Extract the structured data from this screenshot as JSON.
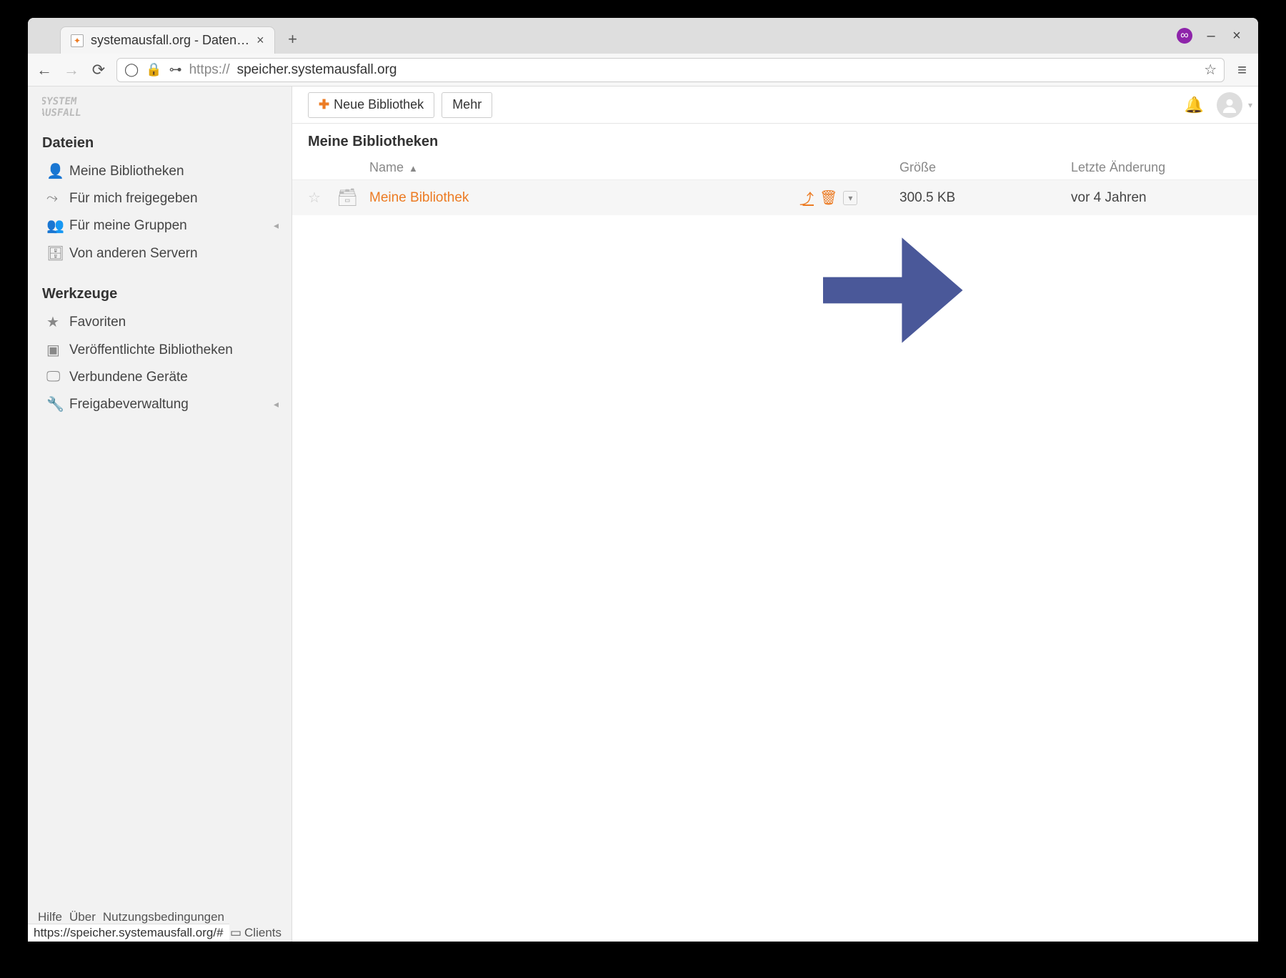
{
  "browser": {
    "tab_title": "systemausfall.org - Daten…",
    "url_proto": "https://",
    "url_host": "speicher.systemausfall.org",
    "status_url": "https://speicher.systemausfall.org/#"
  },
  "topbar": {
    "new_library_label": "Neue Bibliothek",
    "more_label": "Mehr"
  },
  "sidebar": {
    "section_files": "Dateien",
    "items_files": [
      {
        "label": "Meine Bibliotheken"
      },
      {
        "label": "Für mich freigegeben"
      },
      {
        "label": "Für meine Gruppen"
      },
      {
        "label": "Von anderen Servern"
      }
    ],
    "section_tools": "Werkzeuge",
    "items_tools": [
      {
        "label": "Favoriten"
      },
      {
        "label": "Veröffentlichte Bibliotheken"
      },
      {
        "label": "Verbundene Geräte"
      },
      {
        "label": "Freigabeverwaltung"
      }
    ],
    "footer": {
      "help": "Hilfe",
      "about": "Über",
      "terms": "Nutzungsbedingungen",
      "clients": "Clients"
    }
  },
  "page": {
    "title": "Meine Bibliotheken",
    "columns": {
      "name": "Name",
      "size": "Größe",
      "modified": "Letzte Änderung"
    },
    "rows": [
      {
        "name": "Meine Bibliothek",
        "size": "300.5 KB",
        "modified": "vor 4 Jahren"
      }
    ]
  }
}
